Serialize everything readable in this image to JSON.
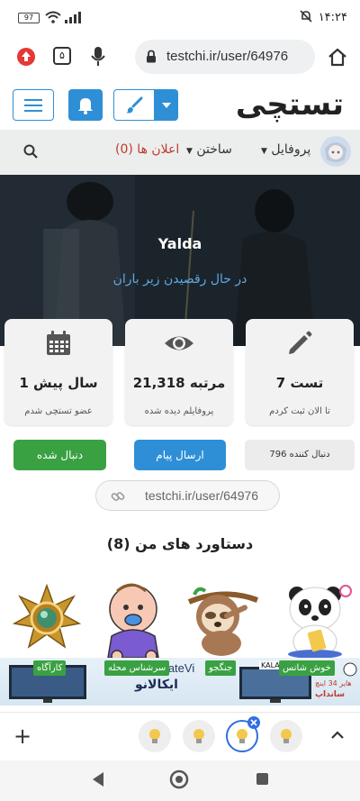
{
  "status_bar": {
    "time": "۱۴:۲۴",
    "battery": "97"
  },
  "browser": {
    "url": "testchi.ir/user/64976",
    "tab_count": "۵",
    "icons": [
      "upload-icon",
      "tabs-icon",
      "mic-icon",
      "lock-icon",
      "home-icon"
    ]
  },
  "site": {
    "logo": "تستچی",
    "nav": {
      "profile": "پروفایل",
      "build": "ساختن",
      "notifications": "اعلان ها",
      "notifications_count": "(0)"
    }
  },
  "profile": {
    "name": "Yalda",
    "status": "در حال رقصیدن زیر باران"
  },
  "stats": [
    {
      "icon": "pencil-icon",
      "value": "7 تست",
      "caption": "تا الان ثبت کردم"
    },
    {
      "icon": "eye-icon",
      "value": "21,318 مرتبه",
      "caption": "پروفایلم دیده شده"
    },
    {
      "icon": "calendar-icon",
      "value": "1 سال پیش",
      "caption": "عضو تستچی شدم"
    }
  ],
  "actions": {
    "followers": "796 دنبال کننده",
    "send_message": "ارسال پیام",
    "following": "دنبال شده"
  },
  "profile_link": "testchi.ir/user/64976",
  "achievements": {
    "title": "دستاورد های من (8)",
    "badges": [
      {
        "label": "خوش شانس",
        "icon": "panda-icon"
      },
      {
        "label": "جنگجو",
        "icon": "sloth-icon"
      },
      {
        "label": "سرشناس محله",
        "icon": "baby-icon"
      },
      {
        "label": "کارآگاه",
        "icon": "medal-icon"
      }
    ]
  },
  "ad": {
    "brand": "MateVi",
    "headline": "ایکالانو",
    "corner": "KALA",
    "sub1": "هایر 34 اینچ",
    "sub2": "سانداپ"
  },
  "tab_bar": {
    "plus": "+",
    "chevron": "^"
  },
  "colors": {
    "primary": "#2f8fd6",
    "success": "#3aa143",
    "danger": "#c0392b"
  }
}
